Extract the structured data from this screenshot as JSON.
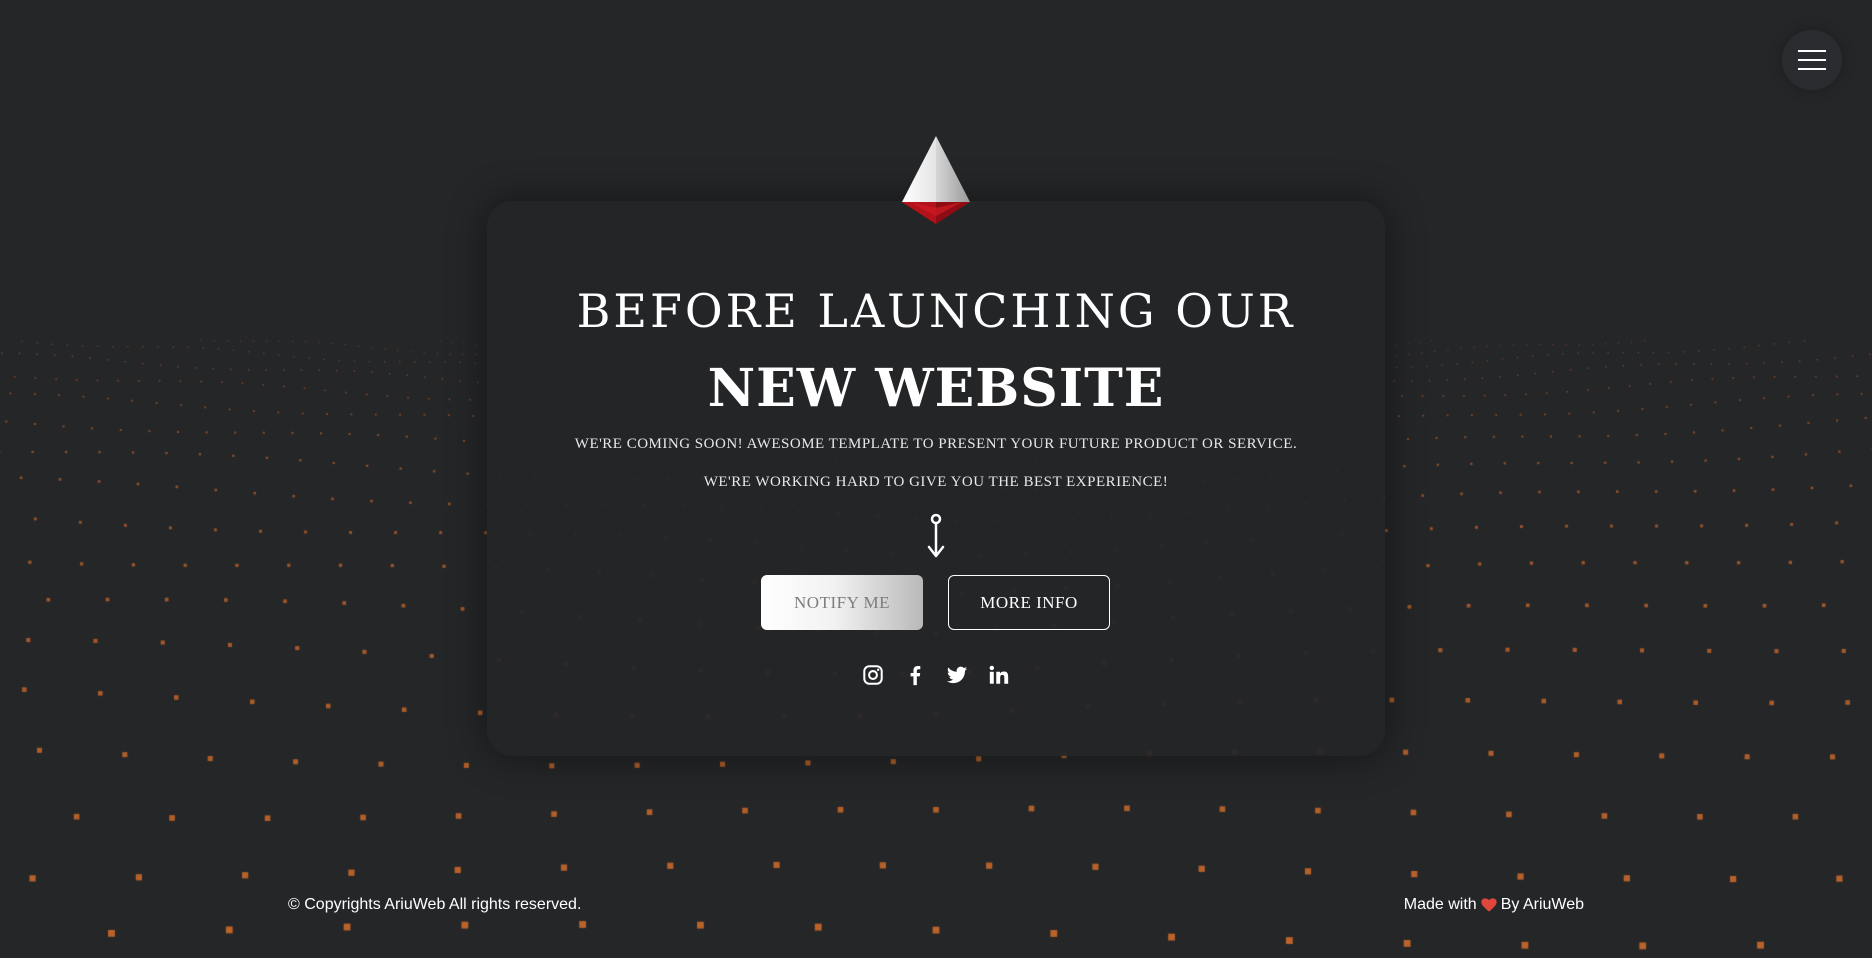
{
  "menu": {
    "icon": "hamburger-menu-icon"
  },
  "logo": {
    "icon": "pyramid-logo-icon",
    "colors": {
      "top": "#ffffff",
      "base": "#b3121a"
    }
  },
  "hero": {
    "title_line1": "BEFORE LAUNCHING OUR",
    "title_line2": "NEW WEBSITE",
    "subtitle_line1": "WE'RE COMING SOON! AWESOME TEMPLATE TO PRESENT YOUR FUTURE PRODUCT OR SERVICE.",
    "subtitle_line2": "WE'RE WORKING HARD TO GIVE YOU THE BEST EXPERIENCE!",
    "arrow_icon": "arrow-down-icon"
  },
  "buttons": {
    "notify_label": "NOTIFY ME",
    "more_info_label": "MORE INFO"
  },
  "social": [
    {
      "name": "instagram-icon"
    },
    {
      "name": "facebook-icon"
    },
    {
      "name": "twitter-icon"
    },
    {
      "name": "linkedin-icon"
    }
  ],
  "footer": {
    "copyright": "© Copyrights AriuWeb All rights reserved.",
    "made_with": "Made with",
    "heart_icon": "heart-icon",
    "by": "By AriuWeb"
  },
  "colors": {
    "background": "#252628",
    "particles": "#c8682a",
    "heart": "#e0463c"
  }
}
